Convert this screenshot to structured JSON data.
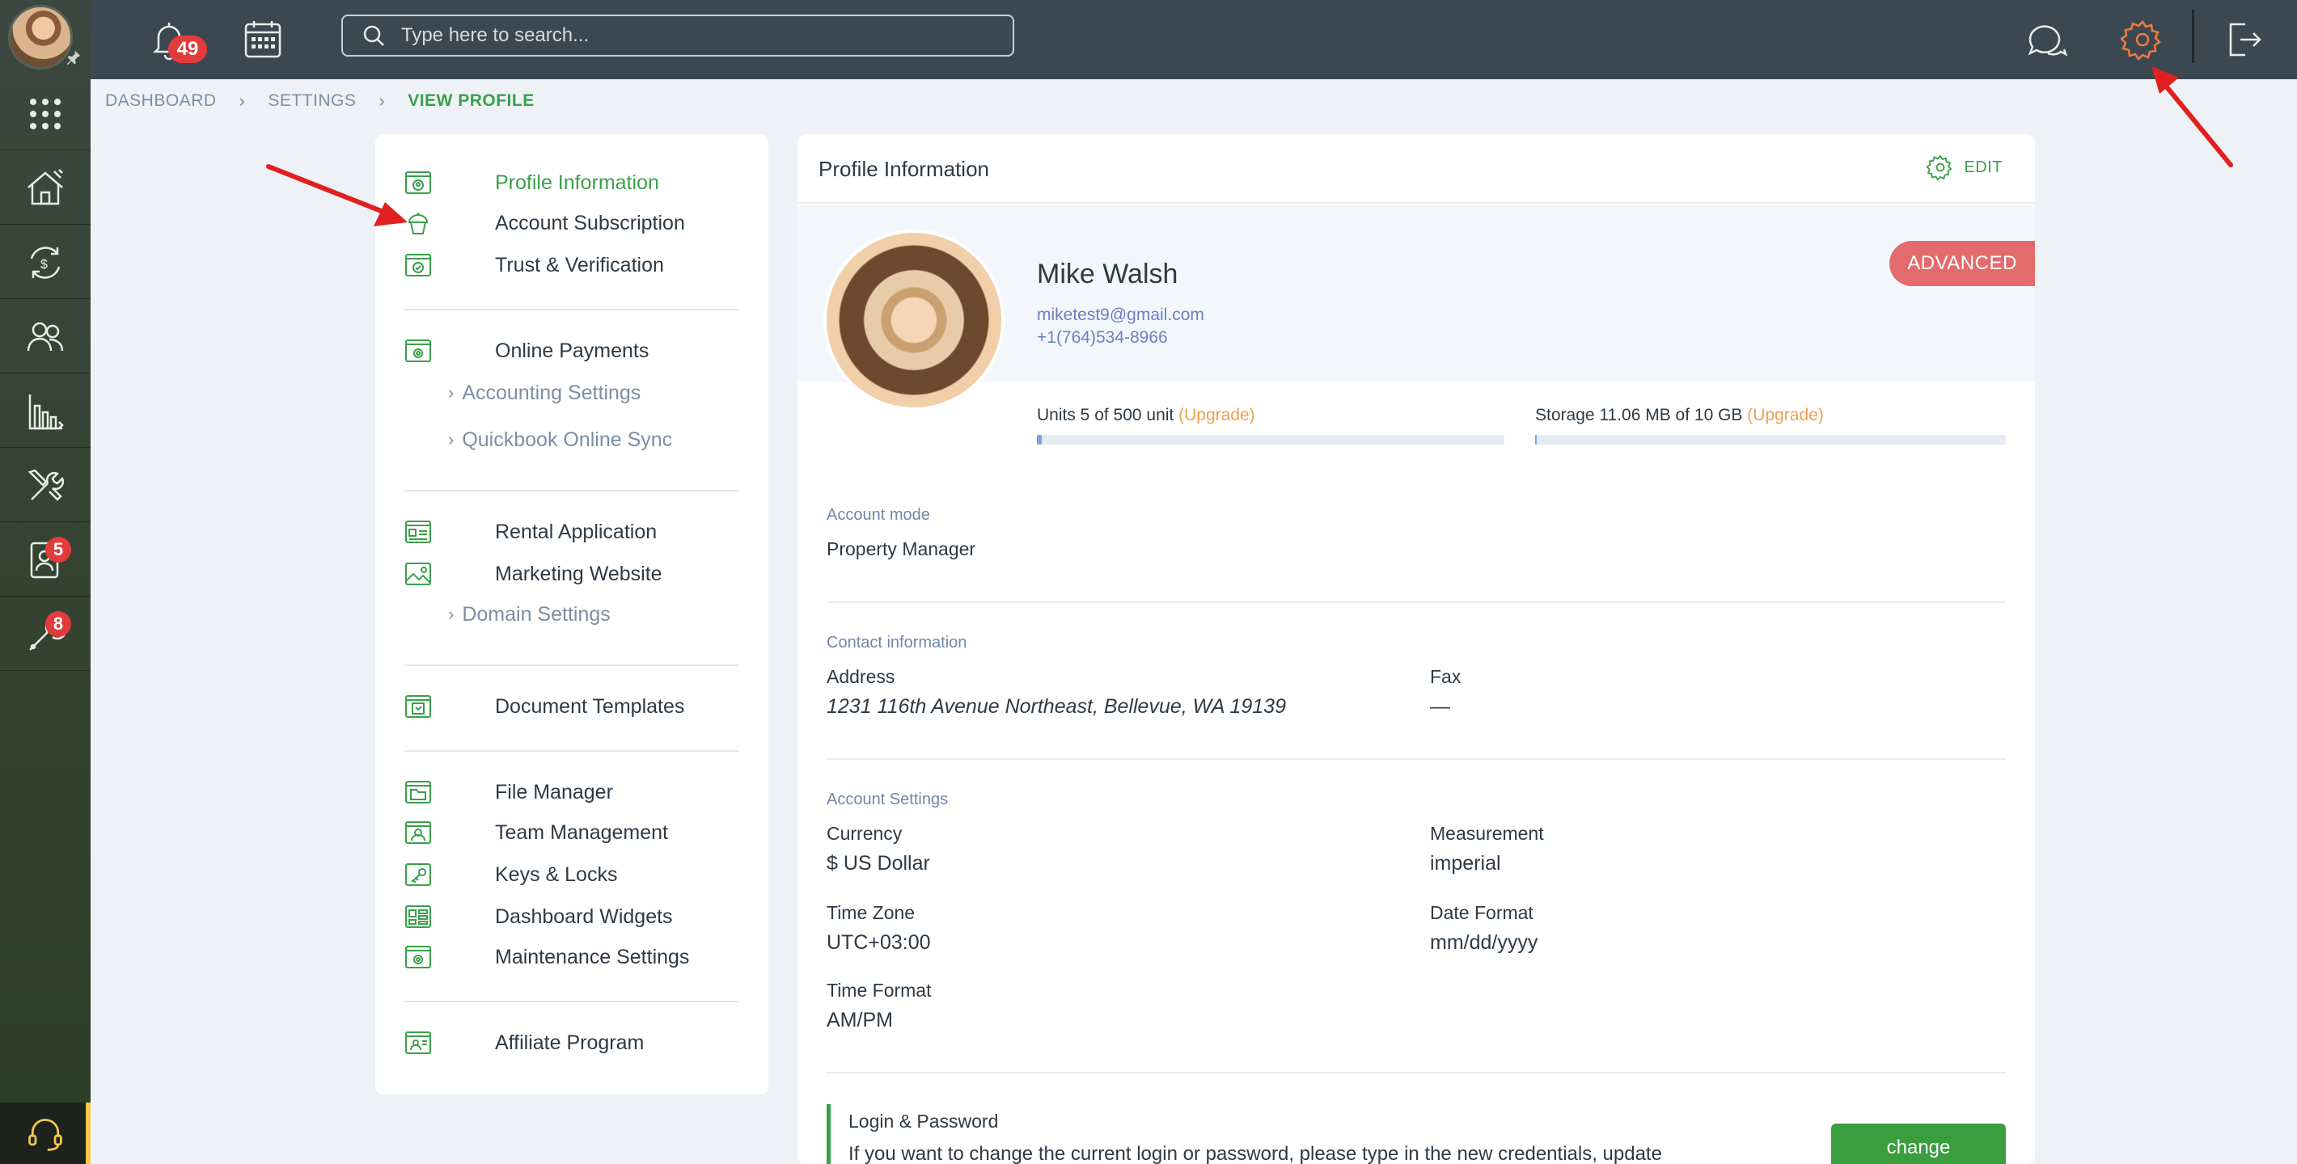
{
  "topbar": {
    "notification_count": "49",
    "search_placeholder": "Type here to search..."
  },
  "rail": {
    "badges": {
      "contacts": "5",
      "maintenance": "8"
    }
  },
  "breadcrumb": {
    "items": [
      "DASHBOARD",
      "SETTINGS",
      "VIEW PROFILE"
    ],
    "separator": "›"
  },
  "settings_nav": {
    "group1": [
      "Profile Information",
      "Account Subscription",
      "Trust & Verification"
    ],
    "group2": {
      "title": "Online Payments",
      "subs": [
        "Accounting Settings",
        "Quickbook Online Sync"
      ]
    },
    "group3": {
      "items": [
        "Rental Application",
        "Marketing Website"
      ],
      "subs": [
        "Domain Settings"
      ]
    },
    "group4": [
      "Document Templates"
    ],
    "group5": [
      "File Manager",
      "Team Management",
      "Keys & Locks",
      "Dashboard Widgets",
      "Maintenance Settings"
    ],
    "group6": [
      "Affiliate Program"
    ]
  },
  "profile": {
    "card_title": "Profile Information",
    "edit_label": "EDIT",
    "name": "Mike Walsh",
    "email": "miketest9@gmail.com",
    "phone": "+1(764)534-8966",
    "plan_badge": "ADVANCED",
    "units_text": "Units 5 of 500 unit",
    "units_fraction": 0.01,
    "storage_text": "Storage 11.06 MB of 10 GB",
    "storage_fraction": 0.002,
    "upgrade_label": "(Upgrade)"
  },
  "account_mode": {
    "section": "Account mode",
    "value": "Property Manager"
  },
  "contact": {
    "section": "Contact information",
    "address_label": "Address",
    "address_value": "1231 116th Avenue Northeast, Bellevue, WA 19139",
    "fax_label": "Fax",
    "fax_value": "—"
  },
  "account_settings": {
    "section": "Account Settings",
    "currency_label": "Currency",
    "currency_value": "$ US Dollar",
    "measurement_label": "Measurement",
    "measurement_value": "imperial",
    "timezone_label": "Time Zone",
    "timezone_value": "UTC+03:00",
    "dateformat_label": "Date Format",
    "dateformat_value": "mm/dd/yyyy",
    "timeformat_label": "Time Format",
    "timeformat_value": "AM/PM"
  },
  "login": {
    "title": "Login & Password",
    "text": "If you want to change the current login or password, please type in the new credentials, update",
    "button": "change"
  },
  "colors": {
    "accent_green": "#3aa04a",
    "badge_red": "#e23b3b",
    "advanced_badge": "#e46b6b",
    "upgrade_orange": "#f0a050",
    "topbar": "#3c4851"
  }
}
